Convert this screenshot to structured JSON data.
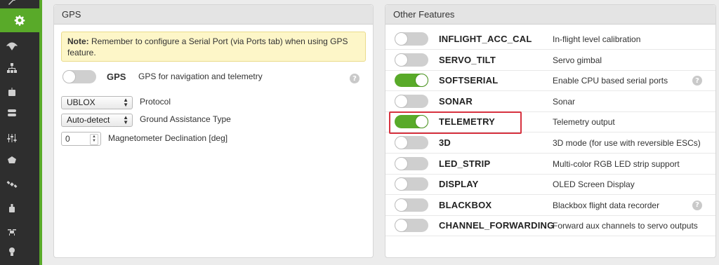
{
  "gps_panel": {
    "title": "GPS",
    "note": {
      "prefix": "Note:",
      "text": " Remember to configure a Serial Port (via Ports tab) when using GPS feature."
    },
    "gps_toggle": {
      "name": "GPS",
      "description": "GPS for navigation and telemetry",
      "enabled": false
    },
    "protocol": {
      "value": "UBLOX",
      "label": "Protocol"
    },
    "ground_assistance": {
      "value": "Auto-detect",
      "label": "Ground Assistance Type"
    },
    "mag_declination": {
      "value": "0",
      "label": "Magnetometer Declination [deg]"
    },
    "help_glyph": "?"
  },
  "features_panel": {
    "title": "Other Features",
    "features": [
      {
        "name": "INFLIGHT_ACC_CAL",
        "description": "In-flight level calibration",
        "enabled": false,
        "help": false
      },
      {
        "name": "SERVO_TILT",
        "description": "Servo gimbal",
        "enabled": false,
        "help": false
      },
      {
        "name": "SOFTSERIAL",
        "description": "Enable CPU based serial ports",
        "enabled": true,
        "help": true
      },
      {
        "name": "SONAR",
        "description": "Sonar",
        "enabled": false,
        "help": false
      },
      {
        "name": "TELEMETRY",
        "description": "Telemetry output",
        "enabled": true,
        "help": false,
        "highlighted": true
      },
      {
        "name": "3D",
        "description": "3D mode (for use with reversible ESCs)",
        "enabled": false,
        "help": false
      },
      {
        "name": "LED_STRIP",
        "description": "Multi-color RGB LED strip support",
        "enabled": false,
        "help": false
      },
      {
        "name": "DISPLAY",
        "description": "OLED Screen Display",
        "enabled": false,
        "help": false
      },
      {
        "name": "BLACKBOX",
        "description": "Blackbox flight data recorder",
        "enabled": false,
        "help": true
      },
      {
        "name": "CHANNEL_FORWARDING",
        "description": "Forward aux channels to servo outputs",
        "enabled": false,
        "help": false
      }
    ],
    "help_glyph": "?"
  },
  "sidebar": {
    "icons": [
      "wrench-icon",
      "gear-icon",
      "parachute-icon",
      "network-icon",
      "robot-icon",
      "toggles-icon",
      "sliders-icon",
      "motor-icon",
      "satellite-icon",
      "bottle-icon",
      "drone-icon",
      "bulb-icon"
    ],
    "active": "gear-icon"
  },
  "colors": {
    "accent": "#59aa29",
    "highlight": "#d7323f",
    "sidebar": "#2e2e2e",
    "note_bg": "#fdf6c8"
  }
}
